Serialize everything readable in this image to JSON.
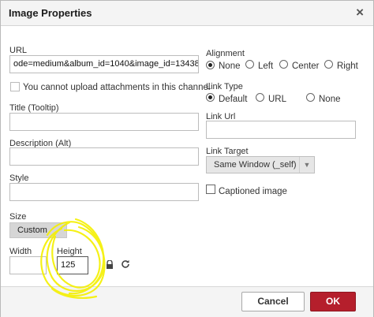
{
  "dialog": {
    "title": "Image Properties",
    "close_glyph": "×"
  },
  "url": {
    "label": "URL",
    "value": "ode=medium&album_id=1040&image_id=13438"
  },
  "upload_notice": "You cannot upload attachments in this channel",
  "title_field": {
    "label": "Title (Tooltip)",
    "value": ""
  },
  "description_field": {
    "label": "Description (Alt)",
    "value": ""
  },
  "style_field": {
    "label": "Style",
    "value": ""
  },
  "size": {
    "label": "Size",
    "selected": "Custom",
    "width_label": "Width",
    "width_value": "",
    "height_label": "Height",
    "height_value": "125"
  },
  "alignment": {
    "label": "Alignment",
    "options": [
      "None",
      "Left",
      "Center",
      "Right"
    ],
    "selected": "None"
  },
  "link_type": {
    "label": "Link Type",
    "options": [
      "Default",
      "URL",
      "None"
    ],
    "selected": "Default"
  },
  "link_url": {
    "label": "Link Url",
    "value": ""
  },
  "link_target": {
    "label": "Link Target",
    "selected": "Same Window (_self)"
  },
  "captioned": {
    "label": "Captioned image",
    "checked": false
  },
  "footer": {
    "cancel_label": "Cancel",
    "ok_label": "OK"
  },
  "colors": {
    "ok_button": "#b51f2c",
    "annotation": "#f5f000"
  },
  "icons": {
    "lock": "lock-icon",
    "reset": "reset-size-icon"
  }
}
